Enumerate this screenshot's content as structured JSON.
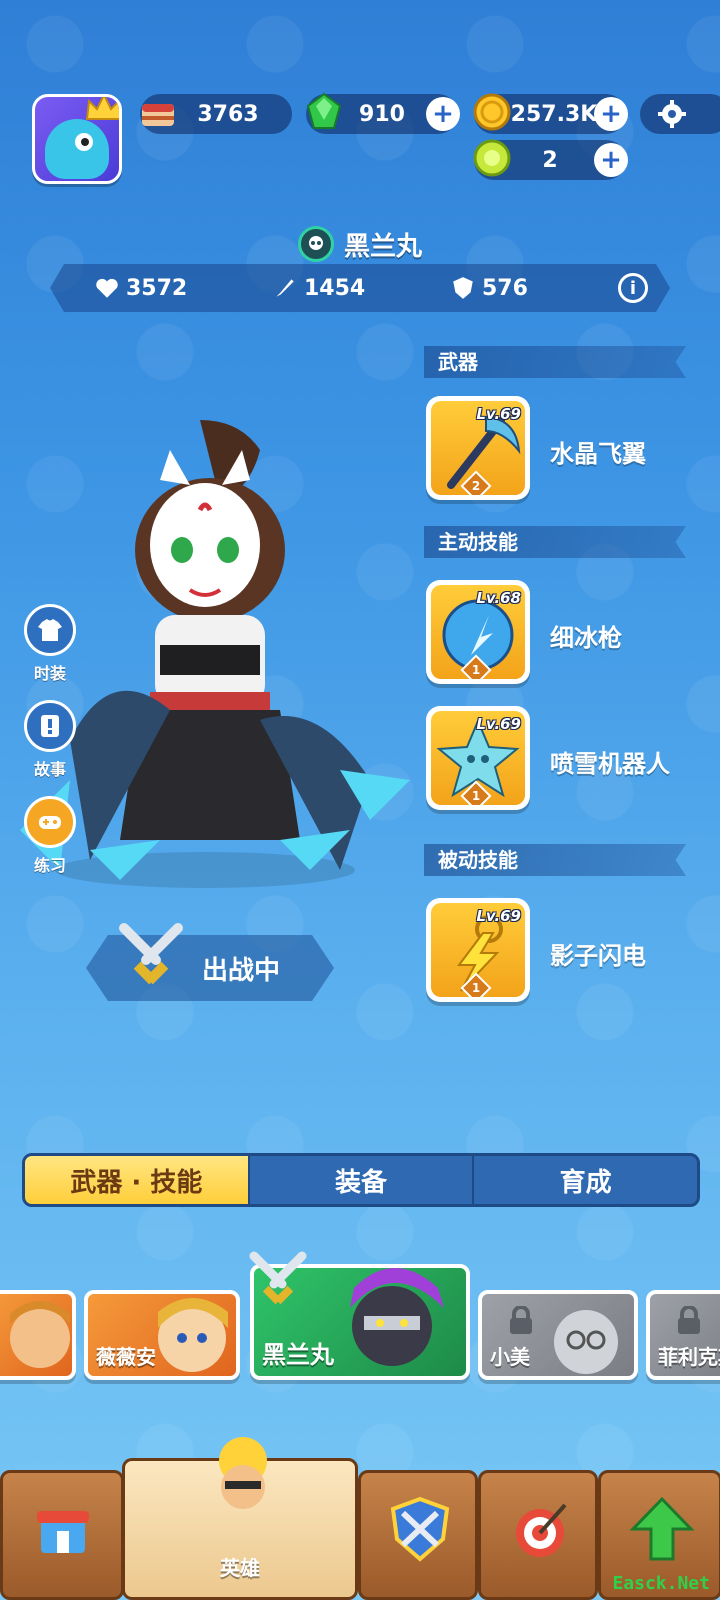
{
  "resources": {
    "cake": "3763",
    "gems": "910",
    "coins": "257.3K",
    "tokens": "2"
  },
  "hero": {
    "name": "黑兰丸",
    "hp": "3572",
    "attack": "1454",
    "defense": "576"
  },
  "sections": {
    "weapon": "武器",
    "active": "主动技能",
    "passive": "被动技能"
  },
  "skills": [
    {
      "name": "水晶飞翼",
      "level": "Lv.69",
      "rank": "2"
    },
    {
      "name": "细冰枪",
      "level": "Lv.68",
      "rank": "1"
    },
    {
      "name": "喷雪机器人",
      "level": "Lv.69",
      "rank": "1"
    },
    {
      "name": "影子闪电",
      "level": "Lv.69",
      "rank": "1"
    }
  ],
  "side_buttons": [
    "时装",
    "故事",
    "练习"
  ],
  "deploy_label": "出战中",
  "tabs": [
    "武器 · 技能",
    "装备",
    "育成"
  ],
  "heroes": [
    "薇薇安",
    "黑兰丸",
    "小美",
    "菲利克斯"
  ],
  "nav": {
    "hero": "英雄"
  },
  "watermark": "Easck.Net",
  "colors": {
    "accent": "#ffce3a",
    "selected_hero": "#24a85a",
    "background": "#3d95e4"
  }
}
